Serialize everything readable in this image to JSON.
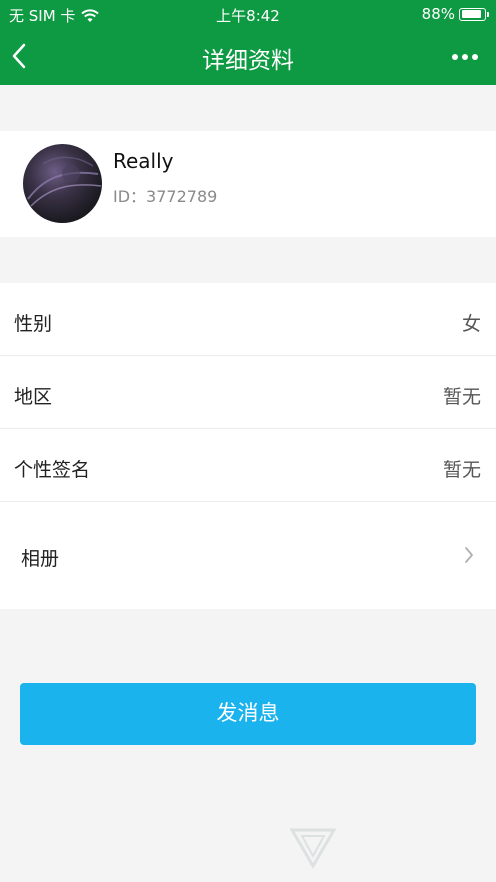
{
  "status_bar": {
    "carrier": "无 SIM 卡",
    "time": "上午8:42",
    "battery": "88%",
    "battery_level": 0.88
  },
  "nav": {
    "title": "详细资料",
    "back_icon": "chevron-left-icon",
    "more_icon": "more-horizontal-icon"
  },
  "profile": {
    "name": "Really",
    "id_text": "ID：3772789"
  },
  "info_rows": [
    {
      "label": "性别",
      "value": "女"
    },
    {
      "label": "地区",
      "value": "暂无"
    },
    {
      "label": "个性签名",
      "value": "暂无"
    },
    {
      "label": "相册",
      "value": ""
    }
  ],
  "actions": {
    "send_message": "发消息"
  },
  "colors": {
    "header": "#0d9a43",
    "button": "#1bb3ed",
    "background": "#f4f4f4"
  }
}
